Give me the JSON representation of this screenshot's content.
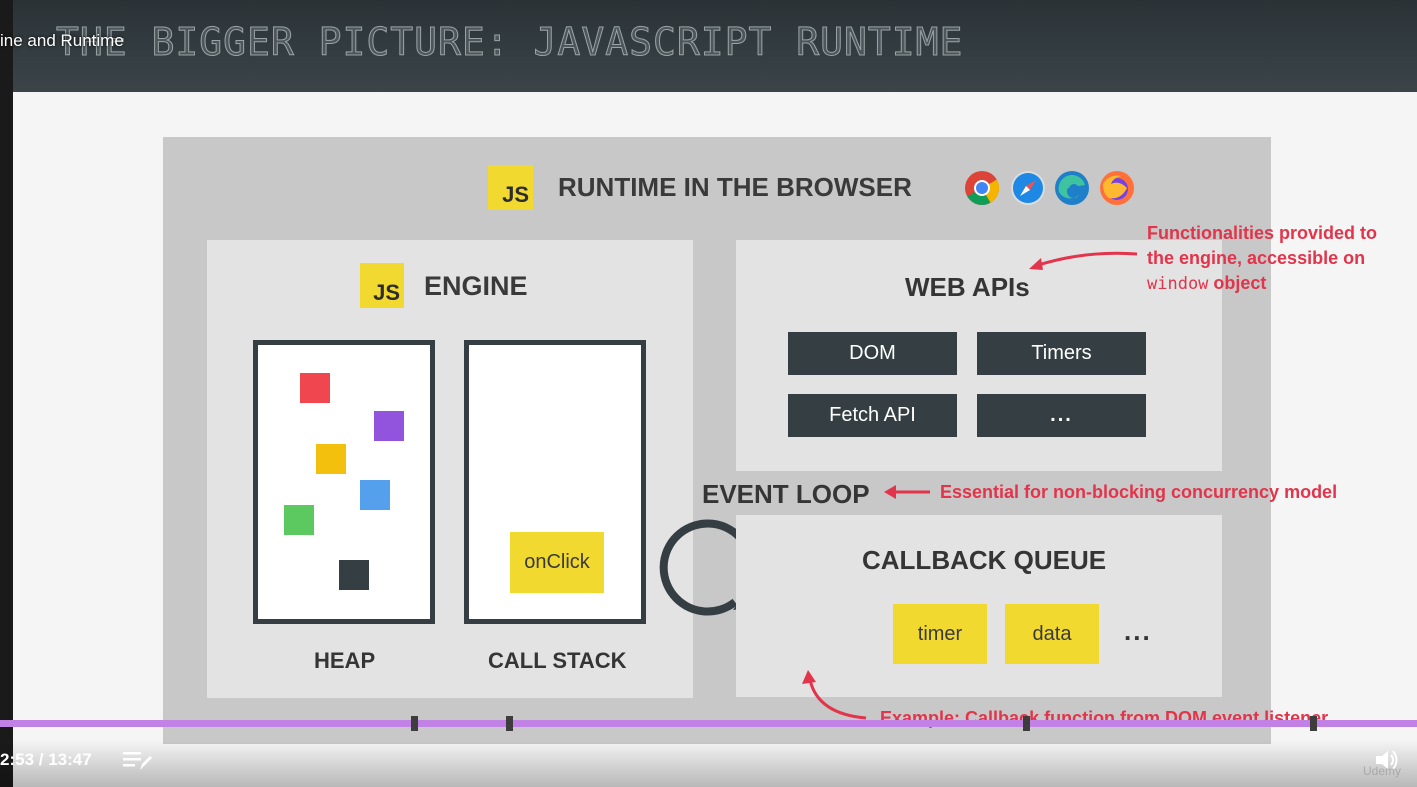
{
  "player": {
    "lecture_title_overlay": "ine and Runtime",
    "time_display": "2:53 / 13:47",
    "progress_percent": 100,
    "watermark": "Udemy",
    "colors": {
      "progress": "#c281e5",
      "marker": "#3d3d3d"
    }
  },
  "slide": {
    "title": "THE BIGGER PICTURE: JAVASCRIPT RUNTIME",
    "js_badge_text": "JS",
    "runtime_title": "RUNTIME IN THE BROWSER",
    "browsers": [
      "chrome-icon",
      "safari-icon",
      "edge-icon",
      "firefox-icon"
    ],
    "engine": {
      "title": "ENGINE",
      "heap_label": "HEAP",
      "call_stack_label": "CALL STACK",
      "call_stack_item": "onClick",
      "heap_colors": [
        "#ef4650",
        "#9254dc",
        "#f3c00e",
        "#54a0ec",
        "#5cc960",
        "#353f43"
      ]
    },
    "web_apis": {
      "title": "WEB APIs",
      "items": [
        "DOM",
        "Timers",
        "Fetch API",
        "..."
      ]
    },
    "event_loop": {
      "label": "EVENT LOOP",
      "note": "Essential for non-blocking concurrency model"
    },
    "callback_queue": {
      "title": "CALLBACK QUEUE",
      "items": [
        "timer",
        "data"
      ],
      "more": "..."
    },
    "notes": {
      "web_apis_line1": "Functionalities provided to",
      "web_apis_line2": "the engine, accessible on",
      "web_apis_code": "window",
      "web_apis_line3_suffix": " object",
      "callback": "Example: Callback function from DOM event listener"
    },
    "colors": {
      "accent_red": "#e2344b",
      "js_yellow": "#f1d930",
      "dark": "#353f43"
    }
  }
}
